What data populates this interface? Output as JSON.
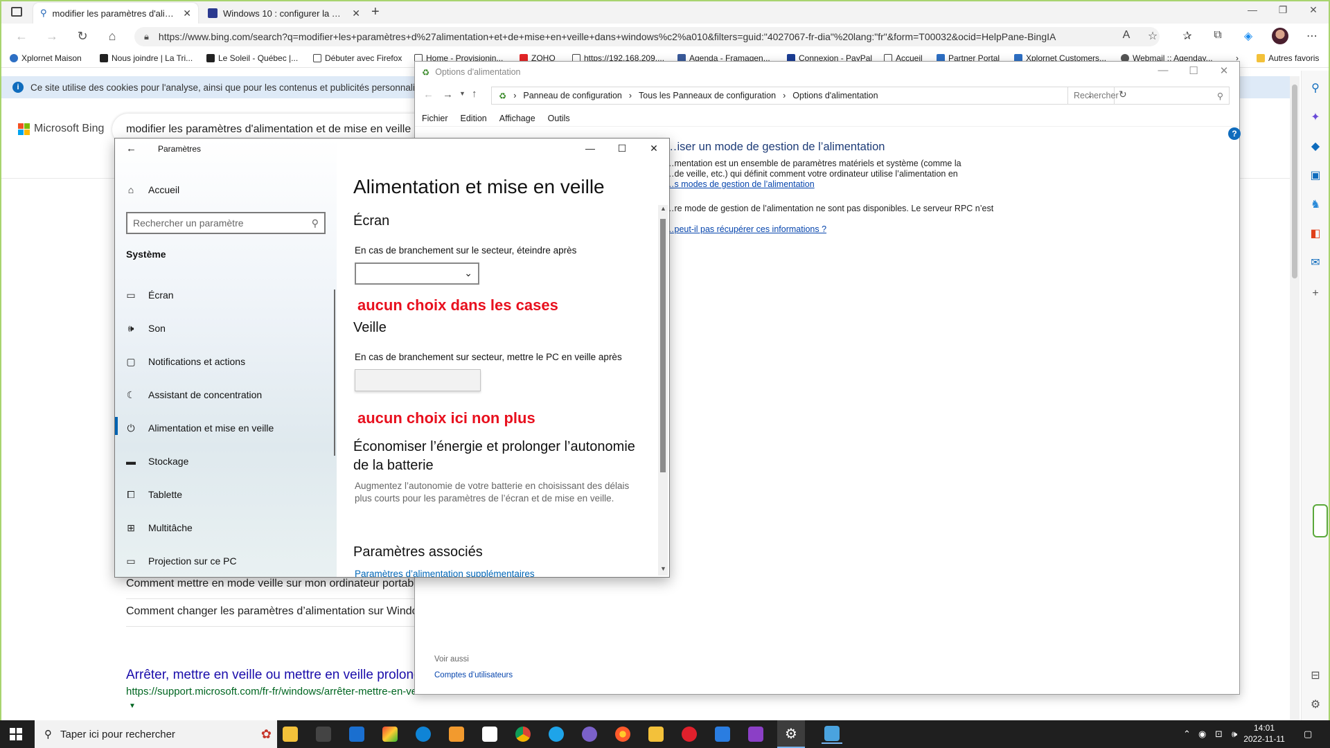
{
  "browser": {
    "tabs": [
      {
        "label": "modifier les paramètres d'alimentation"
      },
      {
        "label": "Windows 10 : configurer la mise en veille"
      }
    ],
    "address": "https://www.bing.com/search?q=modifier+les+paramètres+d%27alimentation+et+de+mise+en+veille+dans+windows%c2%a010&filters=guid:\"4027067-fr-dia\"%20lang:\"fr\"&form=T00032&ocid=HelpPane-BingIA",
    "bookmarks": [
      {
        "label": "Xplornet Maison",
        "color": "#2d6fc4"
      },
      {
        "label": "Nous joindre | La Tri...",
        "color": "#222222"
      },
      {
        "label": "Le Soleil - Québec |...",
        "color": "#222222"
      },
      {
        "label": "Débuter avec Firefox",
        "color": "#ffffff"
      },
      {
        "label": "Home - Provisionin...",
        "color": "#ffffff"
      },
      {
        "label": "ZOHO",
        "color": "#e42527"
      },
      {
        "label": "https://192.168.209....",
        "color": "#ffffff"
      },
      {
        "label": "Agenda - Framagen...",
        "color": "#3a5a9a"
      },
      {
        "label": "Connexion - PayPal",
        "color": "#1b3d94"
      },
      {
        "label": "Accueil",
        "color": "#ffffff"
      },
      {
        "label": "Partner Portal",
        "color": "#2d6fc4"
      },
      {
        "label": "Xplornet Customers...",
        "color": "#2d6fc4"
      },
      {
        "label": "Webmail :: Agenday...",
        "color": "#555555"
      }
    ],
    "other_favorites": "Autres favoris",
    "cookie_banner": "Ce site utilise des cookies pour l'analyse, ainsi que pour les contenus et publicités personnalisés."
  },
  "bing": {
    "logo": "Microsoft Bing",
    "query": "modifier les paramètres d'alimentation et de mise en veille",
    "related": [
      "Comment mettre en mode veille sur mon ordinateur portable",
      "Comment changer les paramètres d’alimentation sur Windows"
    ],
    "result_title": "Arrêter, mettre en veille ou mettre en veille prolongée",
    "result_url": "https://support.microsoft.com/fr-fr/windows/arrêter-mettre-en-veille-ou-mettre-en..."
  },
  "control_panel": {
    "title": "Options d'alimentation",
    "breadcrumb": [
      "Panneau de configuration",
      "Tous les Panneaux de configuration",
      "Options d'alimentation"
    ],
    "search_placeholder": "Rechercher",
    "menu": [
      "Fichier",
      "Edition",
      "Affichage",
      "Outils"
    ],
    "heading": "…iser un mode de gestion de l’alimentation",
    "line1": "…mentation est un ensemble de paramètres matériels et système (comme la",
    "line2": "…de veille, etc.) qui définit comment votre ordinateur utilise l’alimentation en",
    "link1": "…s modes de gestion de l’alimentation",
    "error": "…re mode de gestion de l’alimentation ne sont pas disponibles. Le serveur RPC n’est",
    "link2": "…peut-il pas récupérer ces informations ?",
    "see_also": "Voir aussi",
    "user_accounts": "Comptes d’utilisateurs"
  },
  "settings": {
    "window_title": "Paramètres",
    "home": "Accueil",
    "search_placeholder": "Rechercher un paramètre",
    "section": "Système",
    "nav": [
      {
        "label": "Écran",
        "icon": "monitor-icon"
      },
      {
        "label": "Son",
        "icon": "speaker-icon"
      },
      {
        "label": "Notifications et actions",
        "icon": "notification-icon"
      },
      {
        "label": "Assistant de concentration",
        "icon": "moon-icon"
      },
      {
        "label": "Alimentation et mise en veille",
        "icon": "power-icon",
        "selected": true
      },
      {
        "label": "Stockage",
        "icon": "storage-icon"
      },
      {
        "label": "Tablette",
        "icon": "tablet-icon"
      },
      {
        "label": "Multitâche",
        "icon": "multitask-icon"
      },
      {
        "label": "Projection sur ce PC",
        "icon": "projection-icon"
      }
    ],
    "page_title": "Alimentation et mise en veille",
    "screen_heading": "Écran",
    "screen_label": "En cas de branchement sur le secteur, éteindre après",
    "screen_value": "",
    "annotation1": "aucun choix dans les cases",
    "sleep_heading": "Veille",
    "sleep_label": "En cas de branchement sur secteur, mettre le PC en veille après",
    "sleep_value": "",
    "annotation2": "aucun choix ici non plus",
    "save_heading": "Économiser l’énergie et prolonger l’autonomie de la batterie",
    "save_text": "Augmentez l’autonomie de votre batterie en choisissant des délais plus courts pour les paramètres de l’écran et de mise en veille.",
    "related_heading": "Paramètres associés",
    "related_link": "Paramètres d’alimentation supplémentaires"
  },
  "taskbar": {
    "search_placeholder": "Taper ici pour rechercher",
    "time": "14:01",
    "date": "2022-11-11"
  }
}
